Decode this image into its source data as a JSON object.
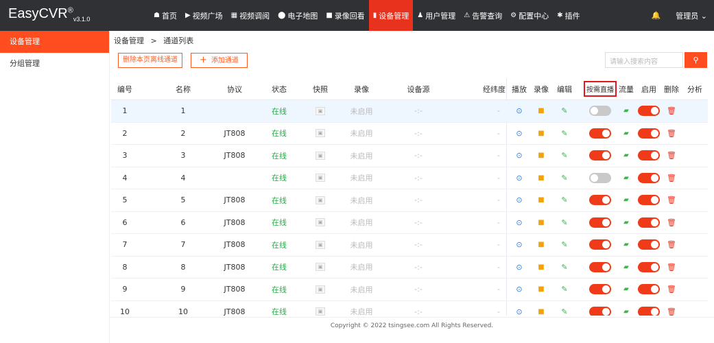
{
  "app": {
    "name": "EasyCVR",
    "reg": "®",
    "version": "v3.1.0"
  },
  "nav": [
    {
      "icon": "home-icon",
      "glyph": "☗",
      "label": "首页",
      "active": false
    },
    {
      "icon": "play-circle-icon",
      "glyph": "▶",
      "label": "视频广场",
      "active": false
    },
    {
      "icon": "grid-icon",
      "glyph": "▦",
      "label": "视频调阅",
      "active": false
    },
    {
      "icon": "map-pin-icon",
      "glyph": "⬤",
      "label": "电子地图",
      "active": false
    },
    {
      "icon": "record-icon",
      "glyph": "■",
      "label": "录像回看",
      "active": false
    },
    {
      "icon": "device-icon",
      "glyph": "▮",
      "label": "设备管理",
      "active": true
    },
    {
      "icon": "user-icon",
      "glyph": "♟",
      "label": "用户管理",
      "active": false
    },
    {
      "icon": "alarm-icon",
      "glyph": "⚠",
      "label": "告警查询",
      "active": false
    },
    {
      "icon": "gear-icon",
      "glyph": "⚙",
      "label": "配置中心",
      "active": false
    },
    {
      "icon": "plugin-icon",
      "glyph": "✱",
      "label": "插件",
      "active": false
    }
  ],
  "topright": {
    "bell": "🔔",
    "user": "管理员",
    "caret": "⌄"
  },
  "sidebar": [
    {
      "label": "设备管理",
      "active": true
    },
    {
      "label": "分组管理",
      "active": false
    }
  ],
  "breadcrumb": {
    "root": "设备管理",
    "sep": ">",
    "current": "通道列表"
  },
  "toolbar": {
    "delete_offline": "删除本页离线通道",
    "add_channel": "添加通道",
    "add_glyph": "+",
    "search_placeholder": "请输入搜索内容",
    "search_glyph": "⚲"
  },
  "columns": {
    "no": "编号",
    "name": "名称",
    "protocol": "协议",
    "status": "状态",
    "snapshot": "快照",
    "record": "录像",
    "source": "设备源",
    "geo": "经纬度",
    "play": "播放",
    "rec": "录像",
    "edit": "编辑",
    "ondemand": "按需直播",
    "flow": "流量",
    "enable": "启用",
    "delete": "删除",
    "analysis": "分析"
  },
  "rows": [
    {
      "no": "1",
      "name": "1",
      "protocol": "",
      "status": "在线",
      "record": "未启用",
      "source": "-:-",
      "geo": "-",
      "ondemand": false,
      "enable": true
    },
    {
      "no": "2",
      "name": "2",
      "protocol": "JT808",
      "status": "在线",
      "record": "未启用",
      "source": "-:-",
      "geo": "-",
      "ondemand": true,
      "enable": true
    },
    {
      "no": "3",
      "name": "3",
      "protocol": "JT808",
      "status": "在线",
      "record": "未启用",
      "source": "-:-",
      "geo": "-",
      "ondemand": true,
      "enable": true
    },
    {
      "no": "4",
      "name": "4",
      "protocol": "",
      "status": "在线",
      "record": "未启用",
      "source": "-:-",
      "geo": "-",
      "ondemand": false,
      "enable": true
    },
    {
      "no": "5",
      "name": "5",
      "protocol": "JT808",
      "status": "在线",
      "record": "未启用",
      "source": "-:-",
      "geo": "-",
      "ondemand": true,
      "enable": true
    },
    {
      "no": "6",
      "name": "6",
      "protocol": "JT808",
      "status": "在线",
      "record": "未启用",
      "source": "-:-",
      "geo": "-",
      "ondemand": true,
      "enable": true
    },
    {
      "no": "7",
      "name": "7",
      "protocol": "JT808",
      "status": "在线",
      "record": "未启用",
      "source": "-:-",
      "geo": "-",
      "ondemand": true,
      "enable": true
    },
    {
      "no": "8",
      "name": "8",
      "protocol": "JT808",
      "status": "在线",
      "record": "未启用",
      "source": "-:-",
      "geo": "-",
      "ondemand": true,
      "enable": true
    },
    {
      "no": "9",
      "name": "9",
      "protocol": "JT808",
      "status": "在线",
      "record": "未启用",
      "source": "-:-",
      "geo": "-",
      "ondemand": true,
      "enable": true
    },
    {
      "no": "10",
      "name": "10",
      "protocol": "JT808",
      "status": "在线",
      "record": "未启用",
      "source": "-:-",
      "geo": "-",
      "ondemand": true,
      "enable": true
    }
  ],
  "icons": {
    "play": "⊙",
    "rec": "■",
    "edit": "✎",
    "flow": "▰",
    "del": "🗑",
    "snap": "▣"
  },
  "footer": "Copyright © 2022 tsingsee.com All Rights Reserved."
}
